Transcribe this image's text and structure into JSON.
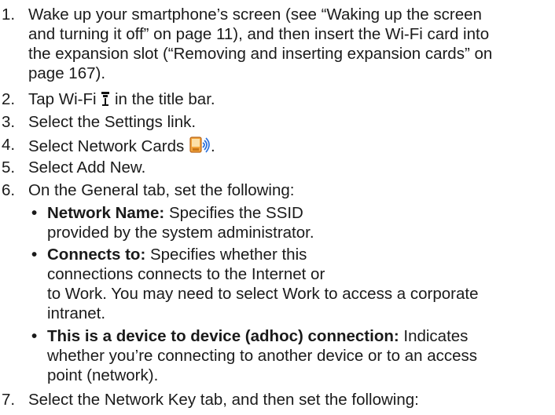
{
  "steps": [
    {
      "num": "1.",
      "lines": [
        "Wake up your smartphone’s screen (see “Waking up the screen",
        "and turning it off” on page 11), and then insert the Wi-Fi card into",
        "the expansion slot (“Removing and inserting expansion cards” on",
        "page 167)."
      ]
    },
    {
      "num": "2.",
      "pre": "Tap Wi-Fi ",
      "post": " in the title bar."
    },
    {
      "num": "3.",
      "text": "Select the Settings link."
    },
    {
      "num": "4.",
      "pre": "Select Network Cards ",
      "post": "."
    },
    {
      "num": "5.",
      "text": "Select Add New."
    },
    {
      "num": "6.",
      "text": "On the General tab, set the following:"
    },
    {
      "num": "7.",
      "text": "Select the Network Key tab, and then set the following:"
    }
  ],
  "bullets": [
    {
      "marker": "•",
      "term": "Network Name:",
      "lines": [
        " Specifies the SSID",
        "provided by the system administrator."
      ]
    },
    {
      "marker": "•",
      "term": "Connects to:",
      "lines": [
        " Specifies whether this",
        "connections connects to the Internet or",
        "to Work. You may need to select Work to access a corporate",
        "intranet."
      ]
    },
    {
      "marker": "•",
      "term": "This is a device to device (adhoc) connection:",
      "lines": [
        " Indicates",
        "whether you’re connecting to another device or to an access",
        "point (network)."
      ]
    }
  ],
  "icons": {
    "wifi": "wifi-signal-icon",
    "network_cards": "network-cards-icon"
  }
}
